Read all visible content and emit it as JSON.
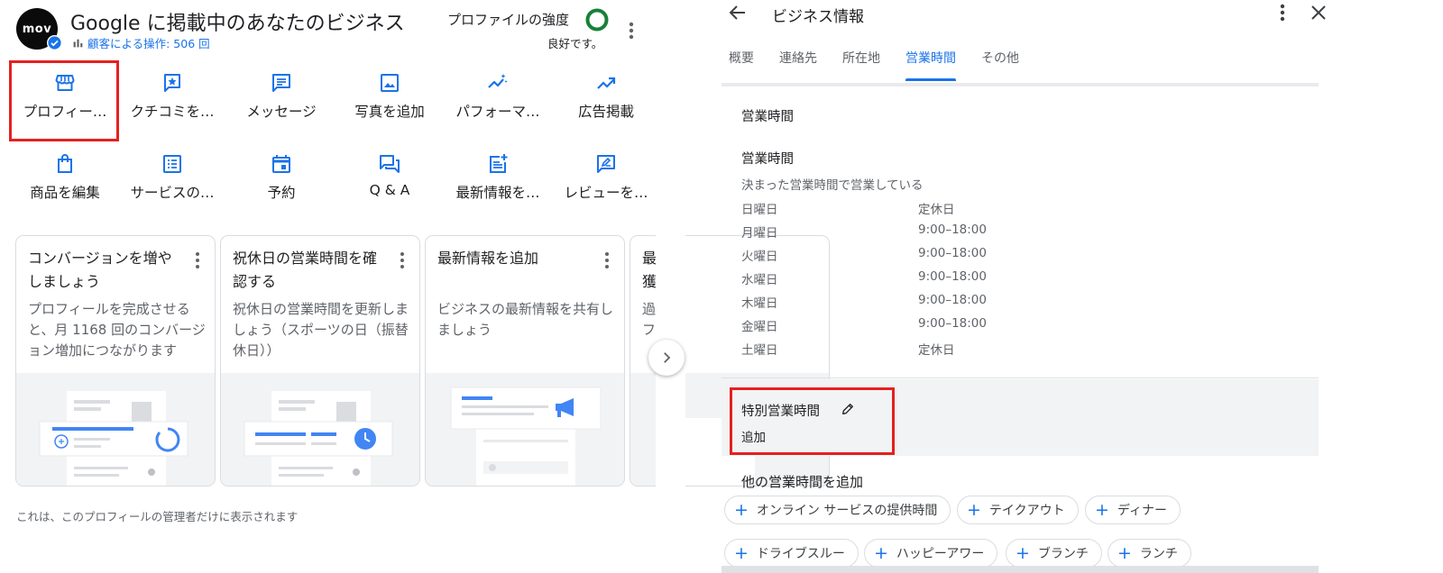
{
  "left": {
    "avatar_text": "mov",
    "title": "Google に掲載中のあなたのビジネス",
    "ops_text": "顧客による操作: 506 回",
    "strength_label": "プロファイルの強度",
    "strength_status": "良好です。",
    "actions_row1": [
      {
        "label": "プロフィー…",
        "icon": "storefront-icon"
      },
      {
        "label": "クチコミを…",
        "icon": "review-star-icon"
      },
      {
        "label": "メッセージ",
        "icon": "message-icon"
      },
      {
        "label": "写真を追加",
        "icon": "photo-icon"
      },
      {
        "label": "パフォーマ…",
        "icon": "performance-icon"
      },
      {
        "label": "広告掲載",
        "icon": "trending-up-icon"
      }
    ],
    "actions_row2": [
      {
        "label": "商品を編集",
        "icon": "shopping-bag-icon"
      },
      {
        "label": "サービスの…",
        "icon": "list-icon"
      },
      {
        "label": "予約",
        "icon": "calendar-icon"
      },
      {
        "label": "Q & A",
        "icon": "qa-icon"
      },
      {
        "label": "最新情報を…",
        "icon": "post-add-icon"
      },
      {
        "label": "レビューを…",
        "icon": "rate-review-icon"
      }
    ],
    "cards": [
      {
        "title": "コンバージョンを増やしましょう",
        "body": "プロフィールを完成させると、月 1168 回のコンバージョン増加につながります"
      },
      {
        "title": "祝休日の営業時間を確認する",
        "body": "祝休日の営業時間を更新しましょう（スポーツの日（振替休日））"
      },
      {
        "title": "最新情報を追加",
        "body": "ビジネスの最新情報を共有しましょう"
      },
      {
        "title": "最獲",
        "body": "過フ"
      }
    ],
    "footer": "これは、このプロフィールの管理者だけに表示されます",
    "colors": {
      "accent": "#1a73e8",
      "highlight": "#e5201f",
      "good": "#188038"
    }
  },
  "right": {
    "title": "ビジネス情報",
    "tabs": [
      "概要",
      "連絡先",
      "所在地",
      "営業時間",
      "その他"
    ],
    "active_tab": "営業時間",
    "section_heading": "営業時間",
    "hours_heading": "営業時間",
    "hours_desc": "決まった営業時間で営業している",
    "hours": [
      {
        "day": "日曜日",
        "time": "定休日"
      },
      {
        "day": "月曜日",
        "time": "9:00–18:00"
      },
      {
        "day": "火曜日",
        "time": "9:00–18:00"
      },
      {
        "day": "水曜日",
        "time": "9:00–18:00"
      },
      {
        "day": "木曜日",
        "time": "9:00–18:00"
      },
      {
        "day": "金曜日",
        "time": "9:00–18:00"
      },
      {
        "day": "土曜日",
        "time": "定休日"
      }
    ],
    "special_title": "特別営業時間",
    "special_add": "追加",
    "other_heading": "他の営業時間を追加",
    "chips_row1": [
      "オンライン サービスの提供時間",
      "テイクアウト",
      "ディナー"
    ],
    "chips_row2": [
      "ドライブスルー",
      "ハッピーアワー",
      "ブランチ",
      "ランチ"
    ]
  }
}
